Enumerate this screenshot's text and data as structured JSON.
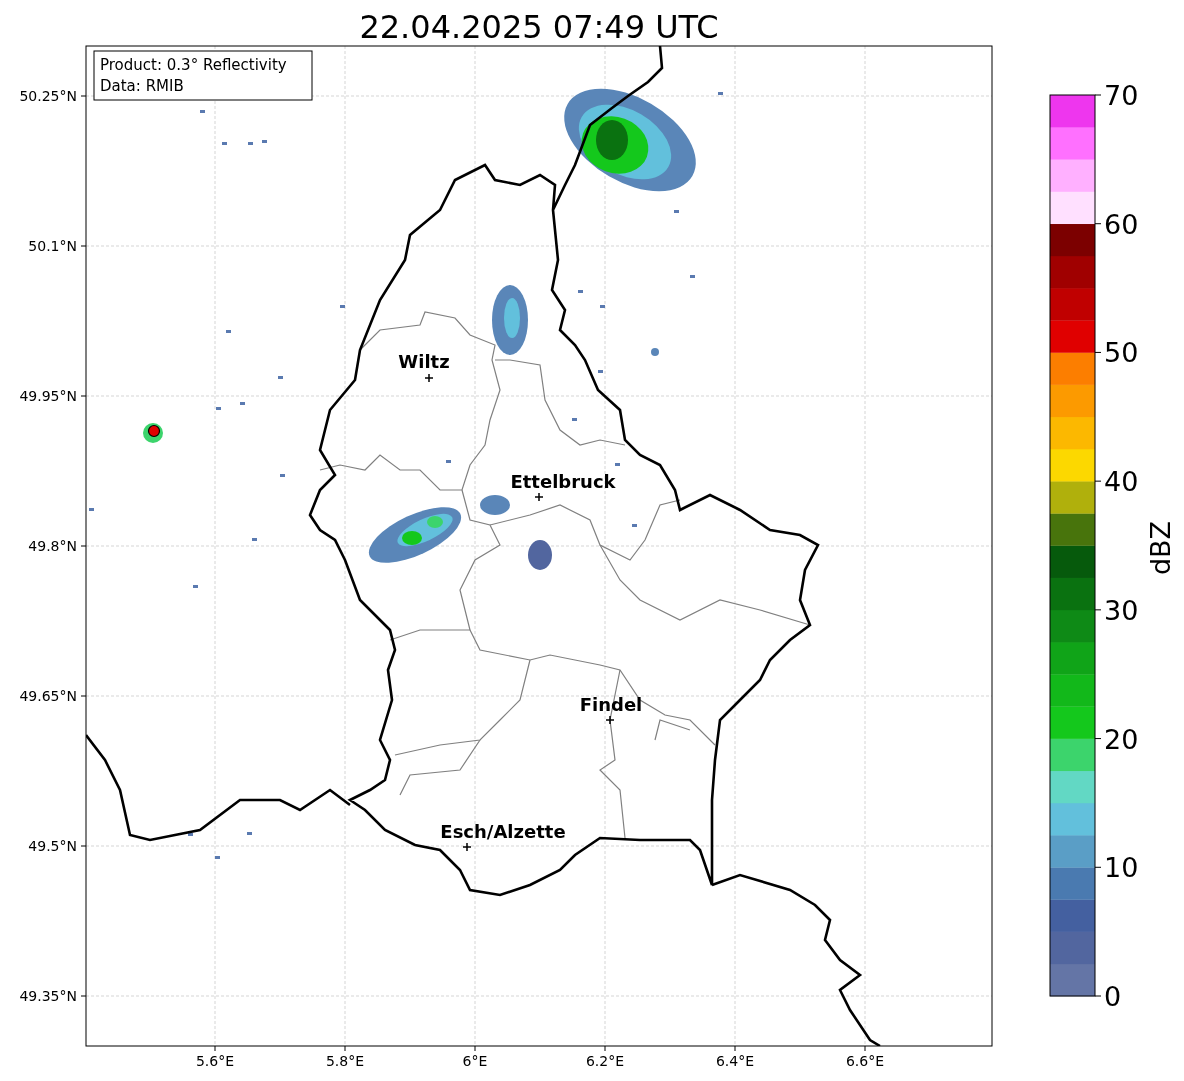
{
  "title": "22.04.2025 07:49 UTC",
  "info_box": {
    "lines": [
      "Product: 0.3° Reflectivity",
      "Data: RMIB"
    ]
  },
  "map": {
    "x_ticks": [
      "5.6°E",
      "5.8°E",
      "6°E",
      "6.2°E",
      "6.4°E",
      "6.6°E"
    ],
    "y_ticks": [
      "50.25°N",
      "50.1°N",
      "49.95°N",
      "49.8°N",
      "49.65°N",
      "49.5°N",
      "49.35°N"
    ],
    "cities": [
      {
        "name": "Wiltz"
      },
      {
        "name": "Ettelbruck"
      },
      {
        "name": "Findel"
      },
      {
        "name": "Esch/Alzette"
      }
    ]
  },
  "colorbar": {
    "label": "dBZ",
    "ticks": [
      "70",
      "60",
      "50",
      "40",
      "30",
      "20",
      "10",
      "0"
    ],
    "bins": [
      {
        "color": "#6475a6"
      },
      {
        "color": "#52669f"
      },
      {
        "color": "#4460a0"
      },
      {
        "color": "#4a7ab0"
      },
      {
        "color": "#5a9ec6"
      },
      {
        "color": "#62c0dc"
      },
      {
        "color": "#62d8c4"
      },
      {
        "color": "#3cd46c"
      },
      {
        "color": "#14c81c"
      },
      {
        "color": "#12b81a"
      },
      {
        "color": "#10a418"
      },
      {
        "color": "#0e8a16"
      },
      {
        "color": "#0a7210"
      },
      {
        "color": "#065a0c"
      },
      {
        "color": "#48740c"
      },
      {
        "color": "#b0b00c"
      },
      {
        "color": "#fcd800"
      },
      {
        "color": "#fcb800"
      },
      {
        "color": "#fc9a00"
      },
      {
        "color": "#fc7e00"
      },
      {
        "color": "#e00000"
      },
      {
        "color": "#c00000"
      },
      {
        "color": "#a00000"
      },
      {
        "color": "#7c0000"
      },
      {
        "color": "#ffe0ff"
      },
      {
        "color": "#ffb0ff"
      },
      {
        "color": "#ff70ff"
      },
      {
        "color": "#ee36ee"
      }
    ]
  }
}
